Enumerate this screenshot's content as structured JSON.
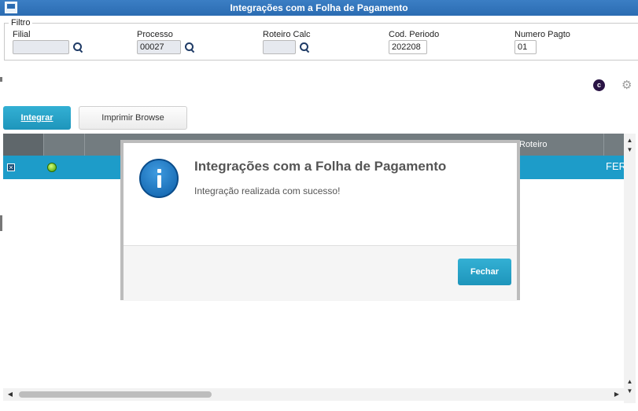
{
  "window": {
    "title": "Integrações com a Folha de Pagamento"
  },
  "filter": {
    "legend": "Filtro",
    "fields": [
      {
        "label": "Filial",
        "value": ""
      },
      {
        "label": "Processo",
        "value": "00027"
      },
      {
        "label": "Roteiro Calc",
        "value": ""
      },
      {
        "label": "Cod. Periodo",
        "value": "202208"
      },
      {
        "label": "Numero Pagto",
        "value": "01"
      }
    ]
  },
  "toolbar": {
    "integrate_label": "Integrar",
    "print_label": "Imprimir Browse",
    "circle_icon_glyph": "c"
  },
  "grid": {
    "columns": [
      "Roteiro"
    ],
    "row": {
      "status": "green",
      "text": "FER"
    }
  },
  "dialog": {
    "title": "Integrações com a Folha de Pagamento",
    "message": "Integração realizada com sucesso!",
    "close_label": "Fechar"
  },
  "colors": {
    "accent": "#1d9cc9",
    "title_bar": "#2b6cb2",
    "header_grey": "#737c80",
    "status_green": "#3c9c00"
  }
}
